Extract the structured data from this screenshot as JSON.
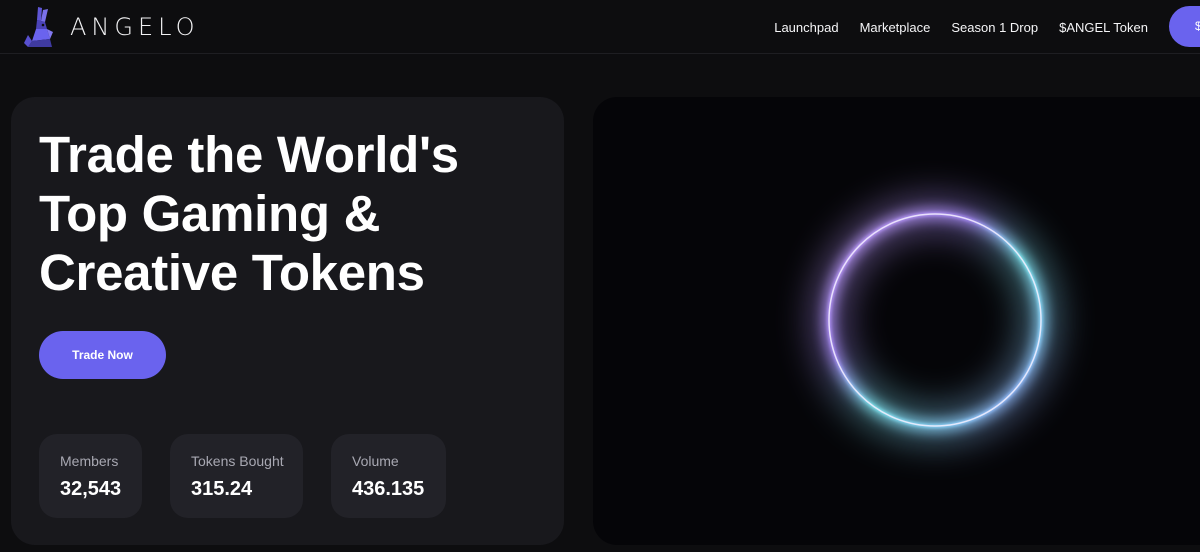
{
  "brand": {
    "name": "ANGELO",
    "logo_icon": "rabbit-logo-icon"
  },
  "nav": {
    "links": [
      "Launchpad",
      "Marketplace",
      "Season 1 Drop",
      "$ANGEL Token"
    ],
    "cta_label": "$"
  },
  "hero": {
    "title": "Trade the World's Top Gaming & Creative Tokens",
    "button_label": "Trade Now"
  },
  "stats": [
    {
      "label": "Members",
      "value": "32,543"
    },
    {
      "label": "Tokens Bought",
      "value": "315.24"
    },
    {
      "label": "Volume",
      "value": "436.135"
    }
  ],
  "visual": {
    "graphic": "glowing-ring"
  },
  "colors": {
    "background": "#0d0d0f",
    "card": "#18181c",
    "stat_card": "#222228",
    "accent": "#6a63ee",
    "ring_cyan": "#7fe6f0",
    "ring_violet": "#b98cf5"
  }
}
